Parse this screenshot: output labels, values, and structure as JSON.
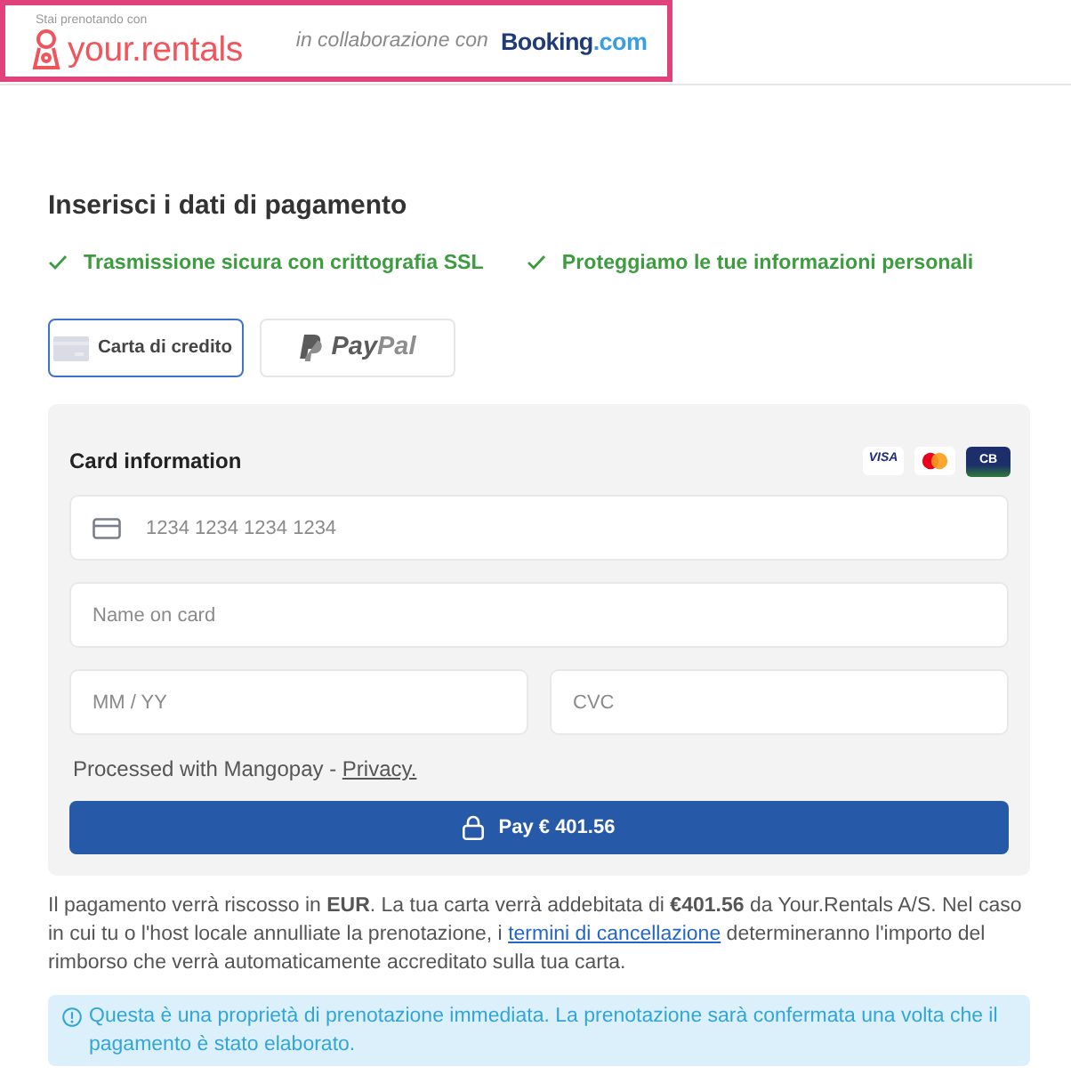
{
  "header": {
    "tagline": "Stai prenotando con",
    "brand": "your.rentals",
    "partner_text": "in collaborazione con",
    "partner_logo": [
      "Booking",
      ".com"
    ]
  },
  "title": "Inserisci i dati di pagamento",
  "assurances": [
    "Trasmissione sicura con crittografia SSL",
    "Proteggiamo le tue informazioni personali"
  ],
  "payment_methods": [
    {
      "kind": "card",
      "label": "Carta di credito",
      "selected": true
    },
    {
      "kind": "paypal",
      "label": [
        "Pay",
        "Pal"
      ],
      "selected": false
    }
  ],
  "card_form": {
    "heading": "Card information",
    "brands": [
      {
        "kind": "visa",
        "text": "VISA"
      },
      {
        "kind": "mastercard"
      },
      {
        "kind": "cb",
        "text": "CB"
      }
    ],
    "fields": [
      {
        "kind": "card_number",
        "placeholder": "1234 1234 1234 1234"
      },
      {
        "kind": "name",
        "placeholder": "Name on card"
      },
      {
        "kind": "expiry",
        "placeholder": "MM / YY"
      },
      {
        "kind": "cvc",
        "placeholder": "CVC"
      }
    ],
    "processor_note": {
      "text": "Processed with Mangopay -",
      "link": "Privacy."
    },
    "pay_button": "Pay € 401.56"
  },
  "notice": {
    "before": "Il pagamento verrà riscosso in **EUR**. La tua carta verrà addebitata di **€401.56** da Your.Rentals A/S. Nel caso in cui tu o l'host locale annulliate la prenotazione, i",
    "link": "termini di cancellazione",
    "after": "determineranno l'importo del rimborso che verrà automaticamente accreditato sulla tua carta."
  },
  "alert": "Questa è una proprietà di prenotazione immediata. La prenotazione sarà confermata una volta che il pagamento è stato elaborato."
}
